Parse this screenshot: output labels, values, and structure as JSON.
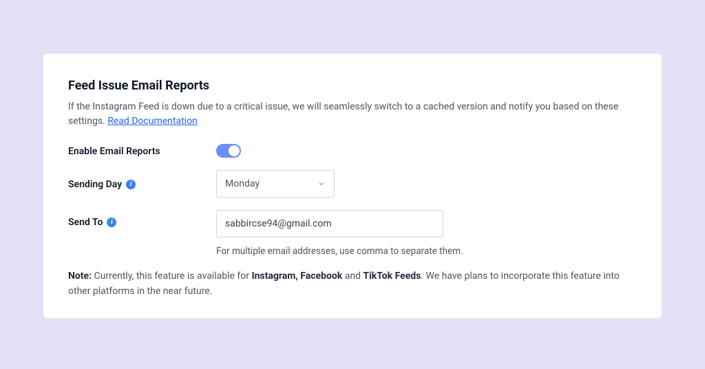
{
  "title": "Feed Issue Email Reports",
  "description_prefix": "If the Instagram Feed is down due to a critical issue, we will seamlessly switch to a cached version and notify you based on these settings. ",
  "doc_link_label": "Read Documentation",
  "enable": {
    "label": "Enable Email Reports",
    "on": true
  },
  "sending_day": {
    "label": "Sending Day",
    "value": "Monday"
  },
  "send_to": {
    "label": "Send To",
    "value": "sabbircse94@gmail.com",
    "helper": "For multiple email addresses, use comma to separate them."
  },
  "note": {
    "prefix": "Note:",
    "before_bold1": " Currently, this feature is available for ",
    "bold1": "Instagram, Facebook",
    "between": " and ",
    "bold2": "TikTok Feeds",
    "after": ". We have plans to incorporate this feature into other platforms in the near future."
  }
}
